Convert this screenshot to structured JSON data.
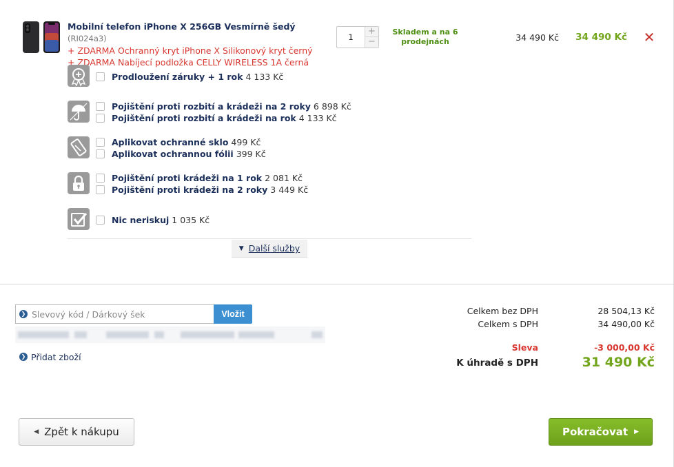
{
  "product": {
    "title": "Mobilní telefon iPhone X 256GB Vesmírně šedý",
    "code": "(RI024a3)",
    "gifts": [
      "+ ZDARMA Ochranný kryt iPhone X Silikonový kryt černý",
      "+ ZDARMA Nabíjecí podložka CELLY WIRELESS 1A černá"
    ],
    "quantity": "1",
    "qty_plus": "+",
    "qty_minus": "−",
    "stock": "Skladem a na 6 prodejnách",
    "unit_price": "34 490 Kč",
    "total_price": "34 490 Kč",
    "remove_symbol": "✕"
  },
  "services": [
    {
      "icon": "warranty-icon",
      "options": [
        {
          "label": "Prodloužení záruky + 1 rok",
          "price": "4 133 Kč"
        }
      ]
    },
    {
      "icon": "umbrella-icon",
      "options": [
        {
          "label": "Pojištění proti rozbití a krádeži na 2 roky",
          "price": "6 898 Kč"
        },
        {
          "label": "Pojištění proti rozbití a krádeži na rok",
          "price": "4 133 Kč"
        }
      ]
    },
    {
      "icon": "screen-protector-icon",
      "options": [
        {
          "label": "Aplikovat ochranné sklo",
          "price": "499 Kč"
        },
        {
          "label": "Aplikovat ochrannou fólii",
          "price": "399 Kč"
        }
      ]
    },
    {
      "icon": "lock-icon",
      "options": [
        {
          "label": "Pojištění proti krádeži na 1 rok",
          "price": "2 081 Kč"
        },
        {
          "label": "Pojištění proti krádeži na 2 roky",
          "price": "3 449 Kč"
        }
      ]
    },
    {
      "icon": "checkmark-icon",
      "options": [
        {
          "label": "Nic neriskuj",
          "price": "1 035 Kč"
        }
      ]
    }
  ],
  "more_services": "Další služby",
  "coupon": {
    "placeholder": "Slevový kód / Dárkový šek",
    "apply_label": "Vložit"
  },
  "add_item": "Přidat zboží",
  "summary": {
    "without_vat_label": "Celkem bez DPH",
    "without_vat_value": "28 504,13 Kč",
    "with_vat_label": "Celkem s DPH",
    "with_vat_value": "34 490,00 Kč",
    "discount_label": "Sleva",
    "discount_value": "-3 000,00 Kč",
    "due_label": "K úhradě s DPH",
    "due_value": "31 490 Kč"
  },
  "nav": {
    "back_label": "Zpět k nákupu",
    "continue_label": "Pokračovat"
  },
  "colors": {
    "title_navy": "#1b2f5a",
    "gift_red": "#d8362f",
    "price_green": "#72a51c",
    "stock_green": "#4f8f14",
    "apply_blue": "#3c8fd0",
    "continue_green": "#78b020"
  }
}
